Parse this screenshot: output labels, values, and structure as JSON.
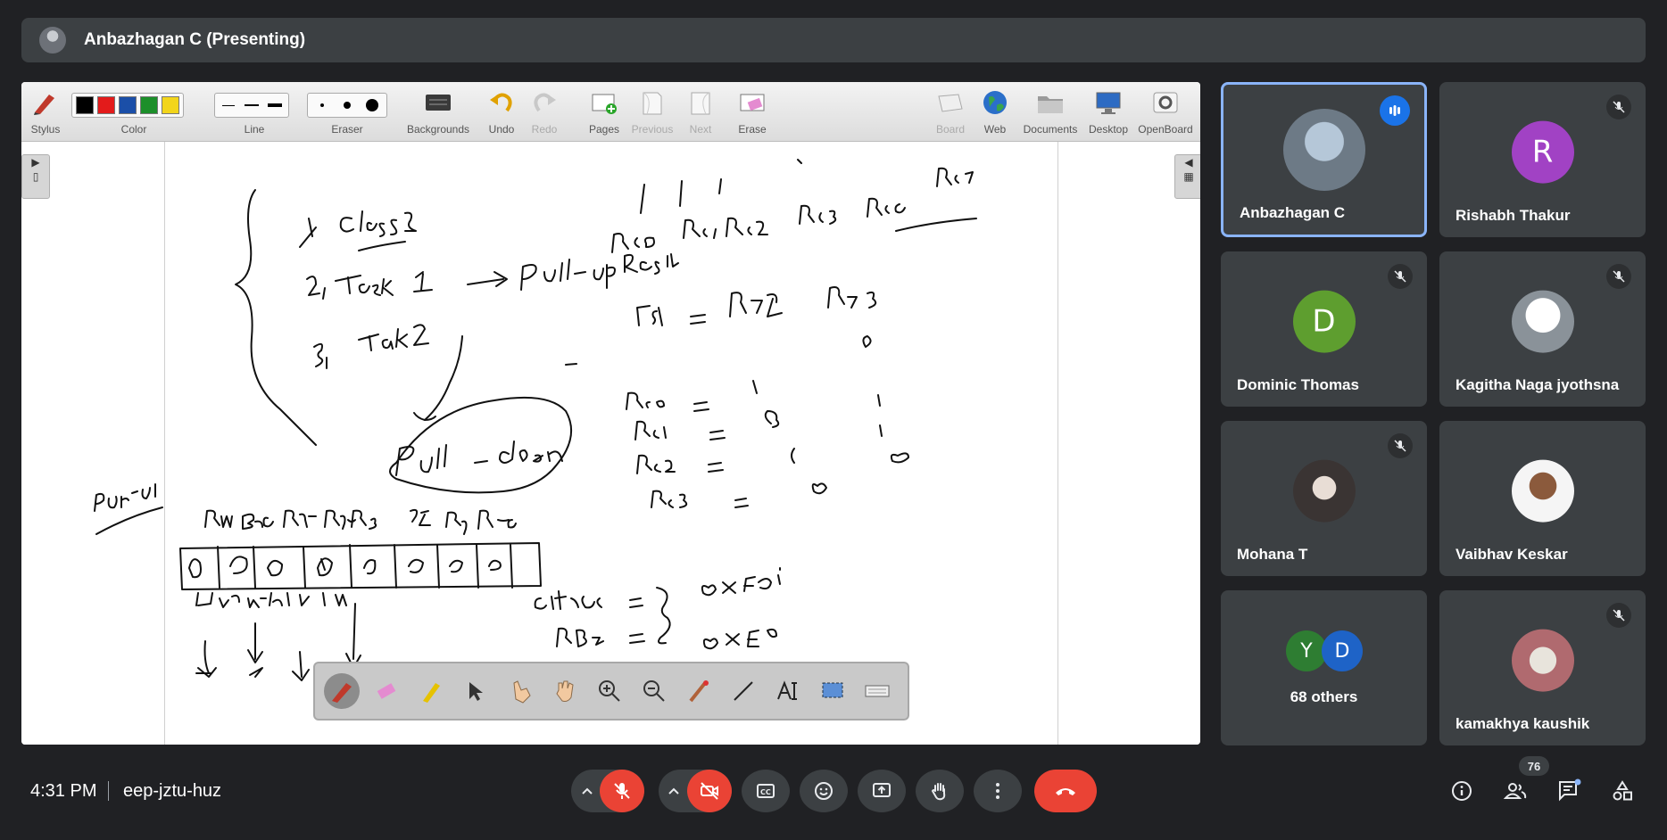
{
  "presenter": {
    "name": "Anbazhagan C (Presenting)"
  },
  "toolbar": {
    "groups": [
      {
        "label": "Stylus"
      },
      {
        "label": "Color"
      },
      {
        "label": "Line"
      },
      {
        "label": "Eraser"
      },
      {
        "label": "Backgrounds"
      },
      {
        "label": "Undo"
      },
      {
        "label": "Redo"
      },
      {
        "label": "Pages"
      },
      {
        "label": "Previous"
      },
      {
        "label": "Next"
      },
      {
        "label": "Erase"
      },
      {
        "label": "Board"
      },
      {
        "label": "Web"
      },
      {
        "label": "Documents"
      },
      {
        "label": "Desktop"
      },
      {
        "label": "OpenBoard"
      }
    ],
    "colors": [
      "#000000",
      "#e31b1b",
      "#1b4fa8",
      "#1c8f2a",
      "#f2d51b"
    ]
  },
  "participants": [
    {
      "name": "Anbazhagan C",
      "initial": "",
      "avatar_color": "#6d7a86",
      "state": "speaking"
    },
    {
      "name": "Rishabh Thakur",
      "initial": "R",
      "avatar_color": "#a142c4",
      "state": "muted"
    },
    {
      "name": "Dominic Thomas",
      "initial": "D",
      "avatar_color": "#5e9e2f",
      "state": "muted"
    },
    {
      "name": "Kagitha Naga jyothsna",
      "initial": "",
      "avatar_color": "#d9d9d9",
      "state": "muted"
    },
    {
      "name": "Mohana T",
      "initial": "",
      "avatar_color": "#7a6f6a",
      "state": "muted"
    },
    {
      "name": "Vaibhav Keskar",
      "initial": "",
      "avatar_color": "#f5f5f5",
      "state": ""
    },
    {
      "name": "kamakhya kaushik",
      "initial": "",
      "avatar_color": "#b06a6f",
      "state": "muted"
    }
  ],
  "others_tile": {
    "label": "68 others",
    "initials": [
      {
        "initial": "Y",
        "color": "#2e7d32"
      },
      {
        "initial": "D",
        "color": "#1e63c7"
      }
    ]
  },
  "bottom_bar": {
    "time": "4:31 PM",
    "meeting_code": "eep-jztu-huz",
    "people_count": "76"
  }
}
